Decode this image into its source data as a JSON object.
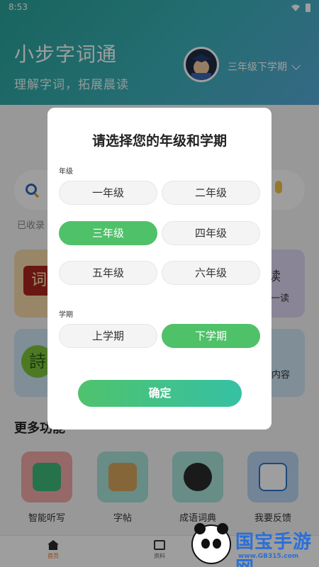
{
  "status_bar": {
    "time": "8:53"
  },
  "header": {
    "title": "小步字词通",
    "subtitle": "理解字词，拓展晨读",
    "current_grade": "三年级下学期"
  },
  "search": {
    "collected_prefix": "已收录"
  },
  "cards": {
    "ci_glyph": "词",
    "du_glyph": "读",
    "du_sub": "一读",
    "shi_glyph": "詩",
    "dian_sub": "点内容"
  },
  "more": {
    "title": "更多功能",
    "features": [
      "智能听写",
      "字帖",
      "成语词典",
      "我要反馈"
    ]
  },
  "tabbar": {
    "home": "首页",
    "data": "资料"
  },
  "watermark": {
    "text": "国宝手游网",
    "url": "www.GB315.com"
  },
  "modal": {
    "title": "请选择您的年级和学期",
    "grade_label": "年级",
    "term_label": "学期",
    "grades": [
      "一年级",
      "二年级",
      "三年级",
      "四年级",
      "五年级",
      "六年级"
    ],
    "selected_grade": "三年级",
    "terms": [
      "上学期",
      "下学期"
    ],
    "selected_term": "下学期",
    "confirm_label": "确定"
  },
  "colors": {
    "accent_green": "#4fc169",
    "header_teal": "#29a39a",
    "active_tab": "#f26b1d"
  },
  "icons": [
    "search-icon",
    "mic-icon",
    "chevron-down-icon",
    "home-icon",
    "document-icon",
    "headphones-icon",
    "pencil-icon"
  ]
}
